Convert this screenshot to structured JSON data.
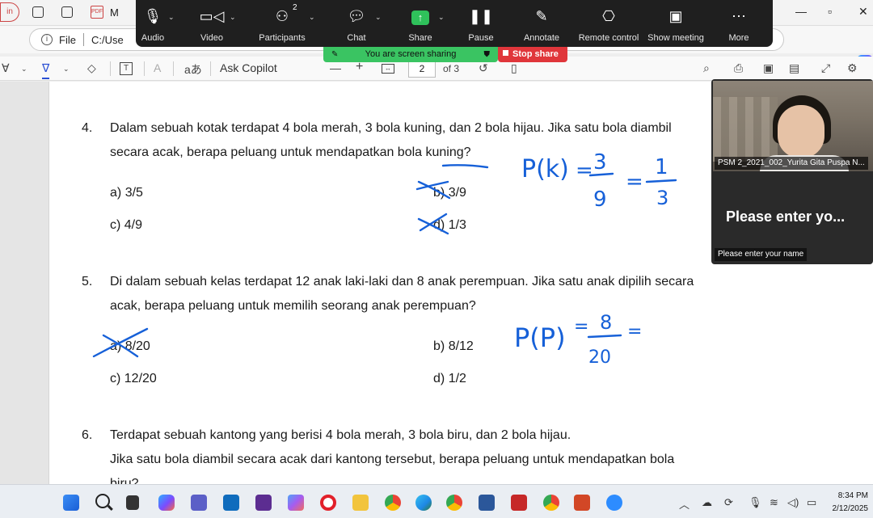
{
  "browser": {
    "tab_title_prefix": "M",
    "pdf_tab_label": "PDF",
    "address_label": "File",
    "address_url": "C:/Use",
    "window_controls": [
      "—",
      "▫",
      "✕"
    ]
  },
  "pdf_toolbar": {
    "ask_copilot": "Ask Copilot",
    "zoom_out": "—",
    "zoom_in": "+",
    "current_page": "2",
    "page_of": "of 3"
  },
  "zoom": {
    "buttons": [
      {
        "label": "Audio",
        "icon": "mic-icon"
      },
      {
        "label": "Video",
        "icon": "video-camera-icon"
      },
      {
        "label": "Participants",
        "icon": "participants-icon"
      },
      {
        "label": "Chat",
        "icon": "chat-icon"
      },
      {
        "label": "Share",
        "icon": "share-screen-icon"
      },
      {
        "label": "Pause",
        "icon": "pause-icon"
      },
      {
        "label": "Annotate",
        "icon": "annotate-pen-icon"
      },
      {
        "label": "Remote control",
        "icon": "remote-control-icon"
      },
      {
        "label": "Show meeting",
        "icon": "show-meeting-icon"
      },
      {
        "label": "More",
        "icon": "more-icon"
      }
    ],
    "participant_count": "2",
    "sharing_banner": "You are screen sharing",
    "stop_share": "Stop share",
    "accent_green": "#3ac462",
    "stop_red": "#e0363b"
  },
  "video": {
    "participant_name": "PSM 2_2021_002_Yurita Gita Puspa N...",
    "enter_name_big": "Please enter yo...",
    "enter_name_small": "Please enter your name"
  },
  "document": {
    "q4": {
      "number": "4.",
      "line1": "Dalam sebuah kotak terdapat 4 bola merah, 3 bola kuning, dan 2 bola hijau. Jika satu bola diambil",
      "line2": "secara acak, berapa peluang untuk mendapatkan bola kuning?",
      "options": [
        {
          "label": "a)",
          "value": "3/5"
        },
        {
          "label": "b)",
          "value": "3/9"
        },
        {
          "label": "c)",
          "value": "4/9"
        },
        {
          "label": "d)",
          "value": "1/3"
        }
      ]
    },
    "q5": {
      "number": "5.",
      "line1": "Di dalam sebuah kelas terdapat 12 anak laki-laki dan 8 anak perempuan. Jika satu anak dipilih secara",
      "line2": "acak, berapa peluang untuk memilih seorang anak perempuan?",
      "options": [
        {
          "label": "a)",
          "value": "8/20"
        },
        {
          "label": "b)",
          "value": "8/12"
        },
        {
          "label": "c)",
          "value": "12/20"
        },
        {
          "label": "d)",
          "value": "1/2"
        }
      ]
    },
    "q6": {
      "number": "6.",
      "line1": "Terdapat sebuah kantong yang berisi 4 bola merah, 3 bola biru, dan 2 bola hijau.",
      "line2": "Jika satu bola diambil secara acak dari kantong tersebut, berapa peluang untuk mendapatkan bola",
      "line3": "biru?"
    },
    "ink_q4": {
      "lhs": "P(k)",
      "num1": "3",
      "den1": "9",
      "num2": "1",
      "den2": "3"
    },
    "ink_q5": {
      "lhs": "P(P)",
      "num1": "8",
      "den1": "20"
    },
    "ink_color": "#1660d8"
  },
  "taskbar": {
    "clock_time": "8:34 PM",
    "clock_date": "2/12/2025",
    "apps": [
      "start-icon",
      "search-icon",
      "task-view-icon",
      "copilot-icon",
      "teams-icon",
      "outlook-icon",
      "visual-studio-icon",
      "m365-icon",
      "opera-icon",
      "file-explorer-icon",
      "chrome-icon",
      "edge-icon",
      "chrome-profile-icon",
      "word-icon",
      "app-red-icon",
      "chrome-k-icon",
      "powerpoint-icon",
      "zoom-app-icon"
    ]
  }
}
